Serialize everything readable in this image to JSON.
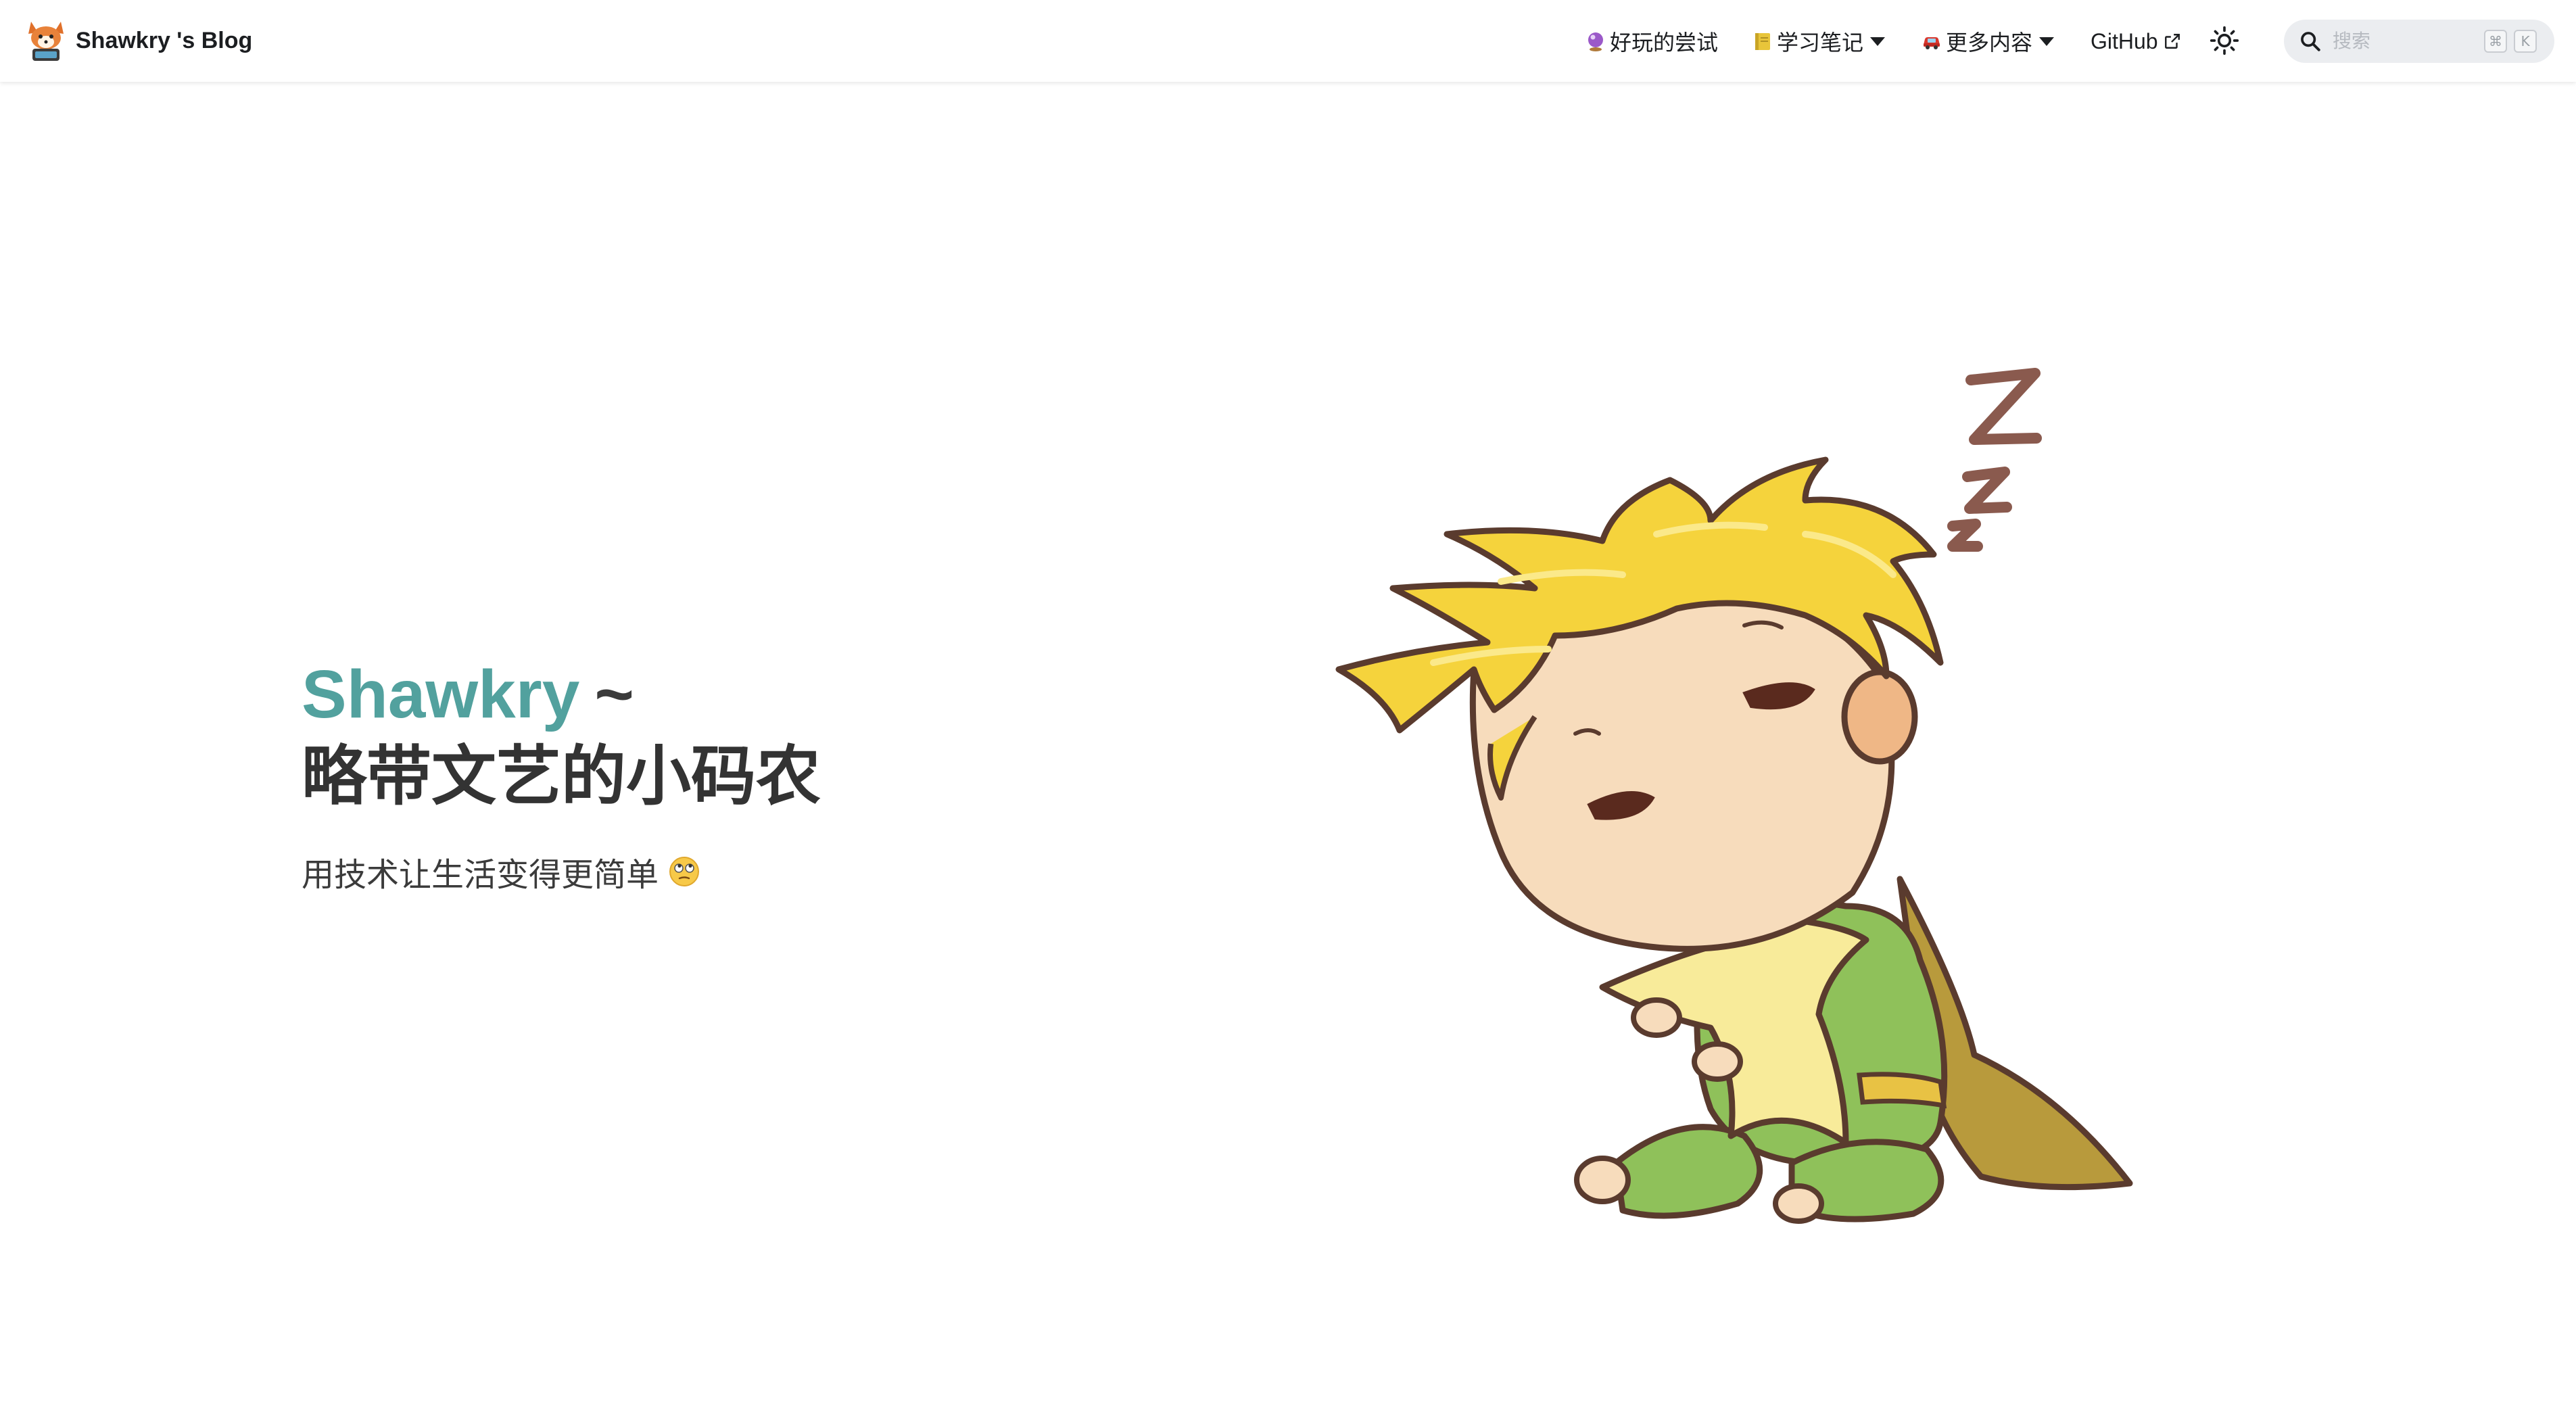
{
  "navbar": {
    "brand_title": "Shawkry 's Blog",
    "items": [
      {
        "label": "好玩的尝试",
        "icon": "crystal-ball-icon",
        "dropdown": false
      },
      {
        "label": "学习笔记",
        "icon": "notebook-icon",
        "dropdown": true
      },
      {
        "label": "更多内容",
        "icon": "car-icon",
        "dropdown": true
      },
      {
        "label": "GitHub",
        "icon": "external-link-icon",
        "dropdown": false
      }
    ],
    "theme_toggle_icon": "sun-icon",
    "search": {
      "placeholder": "搜索",
      "shortcut_keys": [
        "⌘",
        "K"
      ]
    }
  },
  "hero": {
    "name": "Shawkry",
    "name_suffix": "~",
    "title": "略带文艺的小码农",
    "subtitle": "用技术让生活变得更简单",
    "subtitle_emoji": "face-with-rolling-eyes-icon",
    "illustration": "sleeping-little-prince-illustration"
  },
  "colors": {
    "accent": "#52a19e",
    "heading": "#333333",
    "navbar_bg": "#ffffff",
    "search_bg": "#ebedf0"
  }
}
